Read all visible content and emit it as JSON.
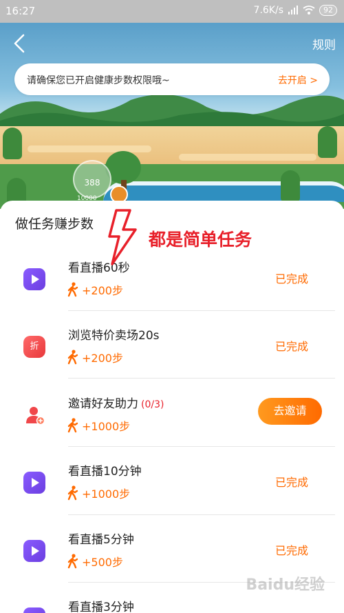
{
  "status_bar": {
    "time": "16:27",
    "speed": "7.6K/s",
    "battery": "92"
  },
  "header": {
    "rules_label": "规则"
  },
  "scene": {
    "steps_bubble": "388",
    "steps_small": "10000"
  },
  "notice": {
    "text": "请确保您已开启健康步数权限哦~",
    "link": "去开启 >"
  },
  "panel": {
    "title": "做任务赚步数"
  },
  "annotation": {
    "text": "都是简单任务"
  },
  "tasks": [
    {
      "title": "看直播60秒",
      "progress": "",
      "reward": "+200步",
      "status": "已完成",
      "icon": "play-icon"
    },
    {
      "title": "浏览特价卖场20s",
      "progress": "",
      "reward": "+200步",
      "status": "已完成",
      "icon": "sale-icon",
      "icon_text": "折"
    },
    {
      "title": "邀请好友助力",
      "progress": "(0/3)",
      "reward": "+1000步",
      "button": "去邀请",
      "icon": "invite-friend-icon"
    },
    {
      "title": "看直播10分钟",
      "progress": "",
      "reward": "+1000步",
      "status": "已完成",
      "icon": "play-icon"
    },
    {
      "title": "看直播5分钟",
      "progress": "",
      "reward": "+500步",
      "status": "已完成",
      "icon": "play-icon"
    },
    {
      "title": "看直播3分钟",
      "progress": "",
      "reward": "",
      "status": "",
      "icon": "play-icon"
    }
  ],
  "colors": {
    "accent": "#ff6a00",
    "annotation": "#e8202a",
    "play_icon": "#7a4cf0"
  },
  "watermark": "Baidu经验"
}
